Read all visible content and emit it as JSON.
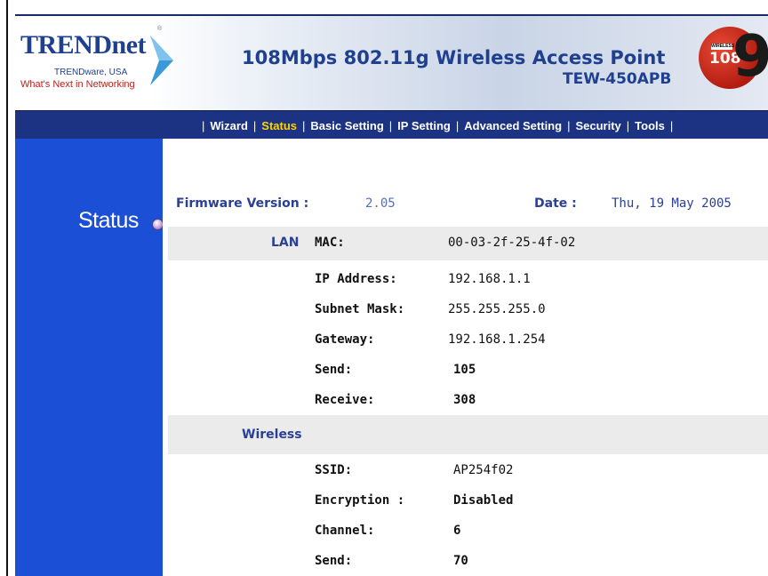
{
  "header": {
    "logo": {
      "wordmark": "TRENDnet",
      "subtitle": "TRENDware, USA",
      "tagline": "What's Next in Networking"
    },
    "title": "108Mbps 802.11g Wireless Access Point",
    "model": "TEW-450APB",
    "badge": {
      "top": "WIRELESS",
      "number": "108",
      "nine": "9"
    }
  },
  "nav": {
    "items": [
      {
        "label": "Wizard"
      },
      {
        "label": "Status"
      },
      {
        "label": "Basic Setting"
      },
      {
        "label": "IP Setting"
      },
      {
        "label": "Advanced Setting"
      },
      {
        "label": "Security"
      },
      {
        "label": "Tools"
      }
    ],
    "active": "Status",
    "separator": "|"
  },
  "sidebar": {
    "label": "Status"
  },
  "status": {
    "firmware_label": "Firmware Version :",
    "firmware_value": "2.05",
    "date_label": "Date :",
    "date_value": "Thu, 19 May 2005",
    "lan": {
      "section": "LAN",
      "rows": [
        {
          "label": "MAC:",
          "value": "00-03-2f-25-4f-02"
        },
        {
          "label": "IP Address:",
          "value": "192.168.1.1"
        },
        {
          "label": "Subnet Mask:",
          "value": "255.255.255.0"
        },
        {
          "label": "Gateway:",
          "value": "192.168.1.254"
        },
        {
          "label": "Send:",
          "value": "105"
        },
        {
          "label": "Receive:",
          "value": "308"
        }
      ]
    },
    "wireless": {
      "section": "Wireless",
      "rows": [
        {
          "label": "SSID:",
          "value": "AP254f02"
        },
        {
          "label": "Encryption :",
          "value": "Disabled"
        },
        {
          "label": "Channel:",
          "value": "6"
        },
        {
          "label": "Send:",
          "value": "70"
        }
      ]
    }
  },
  "colors": {
    "nav_bg": "#1c3383",
    "nav_active": "#ffd200",
    "sidebar_bg": "#1a4fd6",
    "label_blue": "#2b3f96",
    "band_gray": "#ebebeb",
    "brand_red": "#b4241b"
  }
}
